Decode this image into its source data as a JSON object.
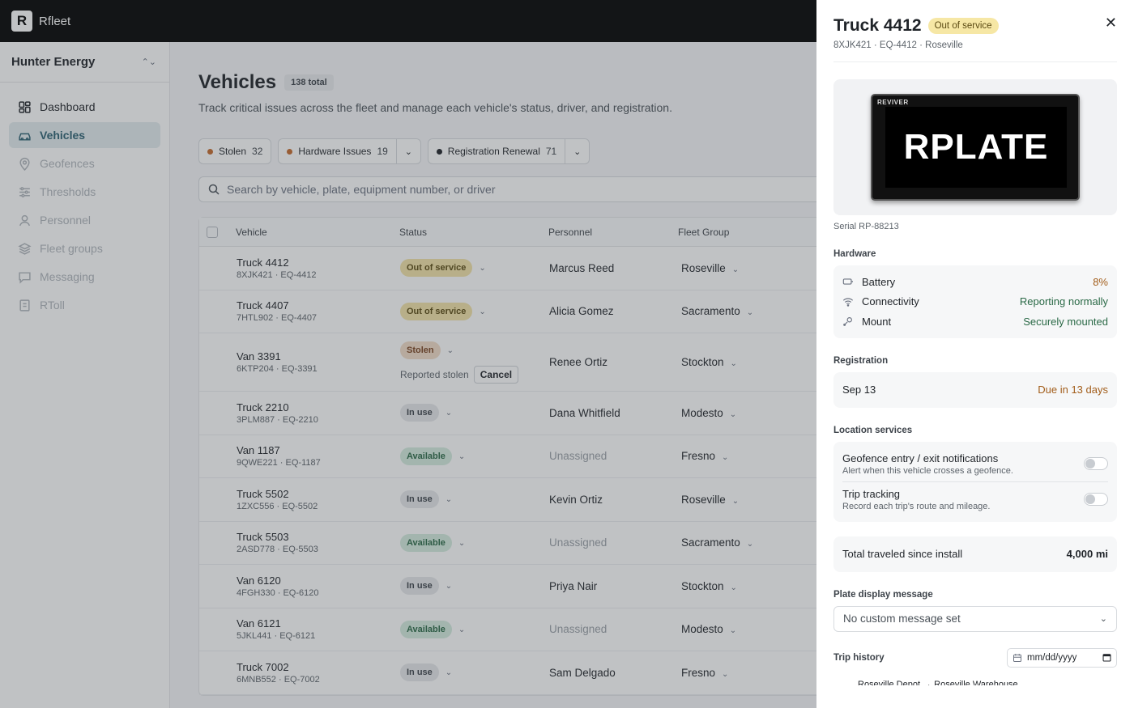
{
  "app": {
    "logo_letter": "R",
    "name": "Rfleet"
  },
  "sidebar": {
    "org_name": "Hunter Energy",
    "items": [
      {
        "label": "Dashboard",
        "icon": "dashboard-icon"
      },
      {
        "label": "Vehicles",
        "icon": "car-icon"
      },
      {
        "label": "Geofences",
        "icon": "map-pin-icon"
      },
      {
        "label": "Thresholds",
        "icon": "sliders-icon"
      },
      {
        "label": "Personnel",
        "icon": "user-icon"
      },
      {
        "label": "Fleet groups",
        "icon": "layers-icon"
      },
      {
        "label": "Messaging",
        "icon": "message-icon"
      },
      {
        "label": "RToll",
        "icon": "toll-icon"
      }
    ]
  },
  "main": {
    "title": "Vehicles",
    "total_badge": "138 total",
    "subtitle": "Track critical issues across the fleet and manage each vehicle's status, driver, and registration.",
    "filters": [
      {
        "label": "Stolen",
        "count": "32",
        "color": "#c56a2d"
      },
      {
        "label": "Hardware Issues",
        "count": "19",
        "color": "#c56a2d"
      },
      {
        "label": "Registration Renewal",
        "count": "71",
        "color": "#1f2328"
      }
    ],
    "search_placeholder": "Search by vehicle, plate, equipment number, or driver",
    "columns": {
      "vehicle": "Vehicle",
      "status": "Status",
      "personnel": "Personnel",
      "fleet": "Fleet Group"
    },
    "rows": [
      {
        "name": "Truck 4412",
        "sub": "8XJK421 · EQ-4412",
        "status": "Out of service",
        "person": "Marcus Reed",
        "fleet": "Roseville"
      },
      {
        "name": "Truck 4407",
        "sub": "7HTL902 · EQ-4407",
        "status": "Out of service",
        "person": "Alicia Gomez",
        "fleet": "Sacramento"
      },
      {
        "name": "Van 3391",
        "sub": "6KTP204 · EQ-3391",
        "status": "Stolen",
        "person": "Renee Ortiz",
        "fleet": "Stockton",
        "note": "Reported stolen",
        "action": "Cancel"
      },
      {
        "name": "Truck 2210",
        "sub": "3PLM887 · EQ-2210",
        "status": "In use",
        "person": "Dana Whitfield",
        "fleet": "Modesto"
      },
      {
        "name": "Van 1187",
        "sub": "9QWE221 · EQ-1187",
        "status": "Available",
        "person": "Unassigned",
        "fleet": "Fresno"
      },
      {
        "name": "Truck 5502",
        "sub": "1ZXC556 · EQ-5502",
        "status": "In use",
        "person": "Kevin Ortiz",
        "fleet": "Roseville"
      },
      {
        "name": "Truck 5503",
        "sub": "2ASD778 · EQ-5503",
        "status": "Available",
        "person": "Unassigned",
        "fleet": "Sacramento"
      },
      {
        "name": "Van 6120",
        "sub": "4FGH330 · EQ-6120",
        "status": "In use",
        "person": "Priya Nair",
        "fleet": "Stockton"
      },
      {
        "name": "Van 6121",
        "sub": "5JKL441 · EQ-6121",
        "status": "Available",
        "person": "Unassigned",
        "fleet": "Modesto"
      },
      {
        "name": "Truck 7002",
        "sub": "6MNB552 · EQ-7002",
        "status": "In use",
        "person": "Sam Delgado",
        "fleet": "Fresno"
      }
    ]
  },
  "panel": {
    "title": "Truck 4412",
    "status_badge": "Out of service",
    "subtitle": "8XJK421 · EQ-4412 · Roseville",
    "plate_brand": "REVIVER",
    "plate_text": "RPLATE",
    "serial": "Serial RP-88213",
    "hardware_label": "Hardware",
    "hardware": [
      {
        "label": "Battery",
        "value": "8%",
        "icon": "battery-icon"
      },
      {
        "label": "Connectivity",
        "value": "Reporting normally",
        "icon": "wifi-icon"
      },
      {
        "label": "Mount",
        "value": "Securely mounted",
        "icon": "mount-icon"
      }
    ],
    "registration_label": "Registration",
    "registration_date": "Sep 13",
    "registration_due": "Due in 13 days",
    "location_label": "Location services",
    "location": [
      {
        "title": "Geofence entry / exit notifications",
        "desc": "Alert when this vehicle crosses a geofence."
      },
      {
        "title": "Trip tracking",
        "desc": "Record each trip's route and mileage."
      }
    ],
    "total_label": "Total traveled since install",
    "total_value": "4,000 mi",
    "plate_message_label": "Plate display message",
    "plate_message_value": "No custom message set",
    "trip_history_label": "Trip history",
    "date_placeholder": "mm/dd/yyyy",
    "trip_peek": "Roseville Depot → Roseville Warehouse"
  }
}
